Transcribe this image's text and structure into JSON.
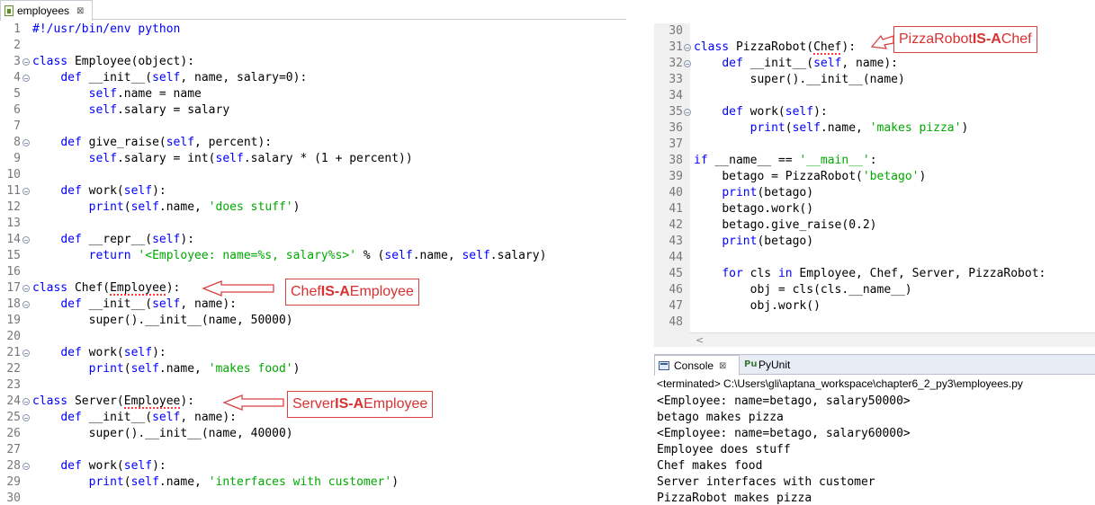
{
  "left_editor": {
    "tab": {
      "label": "employees",
      "close": "⊠"
    },
    "lines": [
      {
        "n": "1",
        "fold": false,
        "toks": [
          [
            "",
            "#!/usr/bin/env python",
            "kw"
          ]
        ]
      },
      {
        "n": "2",
        "fold": false,
        "toks": []
      },
      {
        "n": "3",
        "fold": true,
        "toks": [
          [
            "",
            "class",
            "kw"
          ],
          [
            "",
            " Employee(object):",
            ""
          ]
        ]
      },
      {
        "n": "4",
        "fold": true,
        "toks": [
          [
            "    ",
            "def",
            "kw"
          ],
          [
            "",
            " __init__(",
            ""
          ],
          [
            "",
            "self",
            "self"
          ],
          [
            "",
            ", name, salary=0):",
            ""
          ]
        ]
      },
      {
        "n": "5",
        "fold": false,
        "toks": [
          [
            "        ",
            "self",
            "self"
          ],
          [
            "",
            ".name = name",
            ""
          ]
        ]
      },
      {
        "n": "6",
        "fold": false,
        "toks": [
          [
            "        ",
            "self",
            "self"
          ],
          [
            "",
            ".salary = salary",
            ""
          ]
        ]
      },
      {
        "n": "7",
        "fold": false,
        "toks": []
      },
      {
        "n": "8",
        "fold": true,
        "toks": [
          [
            "    ",
            "def",
            "kw"
          ],
          [
            "",
            " give_raise(",
            ""
          ],
          [
            "",
            "self",
            "self"
          ],
          [
            "",
            ", percent):",
            ""
          ]
        ]
      },
      {
        "n": "9",
        "fold": false,
        "toks": [
          [
            "        ",
            "self",
            "self"
          ],
          [
            "",
            ".salary = int(",
            ""
          ],
          [
            "",
            "self",
            "self"
          ],
          [
            "",
            ".salary * (1 + percent))",
            ""
          ]
        ]
      },
      {
        "n": "10",
        "fold": false,
        "toks": []
      },
      {
        "n": "11",
        "fold": true,
        "toks": [
          [
            "    ",
            "def",
            "kw"
          ],
          [
            "",
            " work(",
            ""
          ],
          [
            "",
            "self",
            "self"
          ],
          [
            "",
            "):",
            ""
          ]
        ]
      },
      {
        "n": "12",
        "fold": false,
        "toks": [
          [
            "        ",
            "print",
            "kw"
          ],
          [
            "",
            "(",
            ""
          ],
          [
            "",
            "self",
            "self"
          ],
          [
            "",
            ".name, ",
            ""
          ],
          [
            "",
            "'does stuff'",
            "str"
          ],
          [
            "",
            ")",
            ""
          ]
        ]
      },
      {
        "n": "13",
        "fold": false,
        "toks": []
      },
      {
        "n": "14",
        "fold": true,
        "toks": [
          [
            "    ",
            "def",
            "kw"
          ],
          [
            "",
            " __repr__(",
            ""
          ],
          [
            "",
            "self",
            "self"
          ],
          [
            "",
            "):",
            ""
          ]
        ]
      },
      {
        "n": "15",
        "fold": false,
        "toks": [
          [
            "        ",
            "return",
            "kw"
          ],
          [
            "",
            " ",
            ""
          ],
          [
            "",
            "'<Employee: name=%s, salary%s>'",
            "str"
          ],
          [
            "",
            " % (",
            ""
          ],
          [
            "",
            "self",
            "self"
          ],
          [
            "",
            ".name, ",
            ""
          ],
          [
            "",
            "self",
            "self"
          ],
          [
            "",
            ".salary)",
            ""
          ]
        ]
      },
      {
        "n": "16",
        "fold": false,
        "toks": []
      },
      {
        "n": "17",
        "fold": true,
        "toks": [
          [
            "",
            "class",
            "kw"
          ],
          [
            "",
            " Chef(",
            ""
          ],
          [
            "",
            "Employee",
            "sq"
          ],
          [
            "",
            "):",
            ""
          ]
        ]
      },
      {
        "n": "18",
        "fold": true,
        "toks": [
          [
            "    ",
            "def",
            "kw"
          ],
          [
            "",
            " __init__(",
            ""
          ],
          [
            "",
            "self",
            "self"
          ],
          [
            "",
            ", name):",
            ""
          ]
        ]
      },
      {
        "n": "19",
        "fold": false,
        "toks": [
          [
            "        ",
            "super().__init__(name, 50000)",
            ""
          ]
        ]
      },
      {
        "n": "20",
        "fold": false,
        "toks": []
      },
      {
        "n": "21",
        "fold": true,
        "toks": [
          [
            "    ",
            "def",
            "kw"
          ],
          [
            "",
            " work(",
            ""
          ],
          [
            "",
            "self",
            "self"
          ],
          [
            "",
            "):",
            ""
          ]
        ]
      },
      {
        "n": "22",
        "fold": false,
        "toks": [
          [
            "        ",
            "print",
            "kw"
          ],
          [
            "",
            "(",
            ""
          ],
          [
            "",
            "self",
            "self"
          ],
          [
            "",
            ".name, ",
            ""
          ],
          [
            "",
            "'makes food'",
            "str"
          ],
          [
            "",
            ")",
            ""
          ]
        ]
      },
      {
        "n": "23",
        "fold": false,
        "toks": []
      },
      {
        "n": "24",
        "fold": true,
        "toks": [
          [
            "",
            "class",
            "kw"
          ],
          [
            "",
            " Server(",
            ""
          ],
          [
            "",
            "Employee",
            "sq"
          ],
          [
            "",
            "):",
            ""
          ]
        ]
      },
      {
        "n": "25",
        "fold": true,
        "toks": [
          [
            "    ",
            "def",
            "kw"
          ],
          [
            "",
            " __init__(",
            ""
          ],
          [
            "",
            "self",
            "self"
          ],
          [
            "",
            ", name):",
            ""
          ]
        ]
      },
      {
        "n": "26",
        "fold": false,
        "toks": [
          [
            "        ",
            "super().__init__(name, 40000)",
            ""
          ]
        ]
      },
      {
        "n": "27",
        "fold": false,
        "toks": []
      },
      {
        "n": "28",
        "fold": true,
        "toks": [
          [
            "    ",
            "def",
            "kw"
          ],
          [
            "",
            " work(",
            ""
          ],
          [
            "",
            "self",
            "self"
          ],
          [
            "",
            "):",
            ""
          ]
        ]
      },
      {
        "n": "29",
        "fold": false,
        "toks": [
          [
            "        ",
            "print",
            "kw"
          ],
          [
            "",
            "(",
            ""
          ],
          [
            "",
            "self",
            "self"
          ],
          [
            "",
            ".name, ",
            ""
          ],
          [
            "",
            "'interfaces with customer'",
            "str"
          ],
          [
            "",
            ")",
            ""
          ]
        ]
      },
      {
        "n": "30",
        "fold": false,
        "toks": []
      }
    ]
  },
  "right_editor": {
    "lines": [
      {
        "n": "30",
        "fold": false,
        "toks": []
      },
      {
        "n": "31",
        "fold": true,
        "toks": [
          [
            "",
            "class",
            "kw"
          ],
          [
            "",
            " PizzaRobot(",
            ""
          ],
          [
            "",
            "Chef",
            "sq"
          ],
          [
            "",
            "):",
            ""
          ]
        ]
      },
      {
        "n": "32",
        "fold": true,
        "toks": [
          [
            "    ",
            "def",
            "kw"
          ],
          [
            "",
            " __init__(",
            ""
          ],
          [
            "",
            "self",
            "self"
          ],
          [
            "",
            ", name):",
            ""
          ]
        ]
      },
      {
        "n": "33",
        "fold": false,
        "toks": [
          [
            "        ",
            "super().__init__(name)",
            ""
          ]
        ]
      },
      {
        "n": "34",
        "fold": false,
        "toks": []
      },
      {
        "n": "35",
        "fold": true,
        "toks": [
          [
            "    ",
            "def",
            "kw"
          ],
          [
            "",
            " work(",
            ""
          ],
          [
            "",
            "self",
            "self"
          ],
          [
            "",
            "):",
            ""
          ]
        ]
      },
      {
        "n": "36",
        "fold": false,
        "toks": [
          [
            "        ",
            "print",
            "kw"
          ],
          [
            "",
            "(",
            ""
          ],
          [
            "",
            "self",
            "self"
          ],
          [
            "",
            ".name, ",
            ""
          ],
          [
            "",
            "'makes pizza'",
            "str"
          ],
          [
            "",
            ")",
            ""
          ]
        ]
      },
      {
        "n": "37",
        "fold": false,
        "toks": []
      },
      {
        "n": "38",
        "fold": false,
        "toks": [
          [
            "",
            "if",
            "kw"
          ],
          [
            "",
            " __name__ == ",
            ""
          ],
          [
            "",
            "'__main__'",
            "str"
          ],
          [
            "",
            ":",
            ""
          ]
        ]
      },
      {
        "n": "39",
        "fold": false,
        "toks": [
          [
            "    ",
            "betago = PizzaRobot(",
            ""
          ],
          [
            "",
            "'betago'",
            "str"
          ],
          [
            "",
            ")",
            ""
          ]
        ]
      },
      {
        "n": "40",
        "fold": false,
        "toks": [
          [
            "    ",
            "print",
            "kw"
          ],
          [
            "",
            "(betago)",
            ""
          ]
        ]
      },
      {
        "n": "41",
        "fold": false,
        "toks": [
          [
            "    ",
            "betago.work()",
            ""
          ]
        ]
      },
      {
        "n": "42",
        "fold": false,
        "toks": [
          [
            "    ",
            "betago.give_raise(0.2)",
            ""
          ]
        ]
      },
      {
        "n": "43",
        "fold": false,
        "toks": [
          [
            "    ",
            "print",
            "kw"
          ],
          [
            "",
            "(betago)",
            ""
          ]
        ]
      },
      {
        "n": "44",
        "fold": false,
        "toks": []
      },
      {
        "n": "45",
        "fold": false,
        "toks": [
          [
            "    ",
            "for",
            "kw"
          ],
          [
            "",
            " cls ",
            ""
          ],
          [
            "",
            "in",
            "kw"
          ],
          [
            "",
            " Employee, Chef, Server, PizzaRobot:",
            ""
          ]
        ]
      },
      {
        "n": "46",
        "fold": false,
        "toks": [
          [
            "        ",
            "obj = cls(cls.__name__)",
            ""
          ]
        ]
      },
      {
        "n": "47",
        "fold": false,
        "toks": [
          [
            "        ",
            "obj.work()",
            ""
          ]
        ]
      },
      {
        "n": "48",
        "fold": false,
        "toks": []
      }
    ],
    "scroll_left": "<"
  },
  "console": {
    "tabs": [
      {
        "label": "Console",
        "close": "⊠"
      },
      {
        "label": "PyUnit",
        "icon": "Pu"
      }
    ],
    "header": "<terminated> C:\\Users\\gli\\aptana_workspace\\chapter6_2_py3\\employees.py",
    "lines": [
      "<Employee: name=betago, salary50000>",
      "betago makes pizza",
      "<Employee: name=betago, salary60000>",
      "Employee does stuff",
      "Chef makes food",
      "Server interfaces with customer",
      "PizzaRobot makes pizza"
    ]
  },
  "annotations": {
    "chef": {
      "pre": "Chef ",
      "bold": "IS-A",
      "post": " Employee"
    },
    "server": {
      "pre": "Server ",
      "bold": "IS-A",
      "post": " Employee"
    },
    "pizza": {
      "pre": "PizzaRobot ",
      "bold": "IS-A",
      "post": " Chef"
    }
  },
  "colors": {
    "keyword": "#0000ff",
    "string": "#00aa00",
    "annotation": "#d93030"
  }
}
